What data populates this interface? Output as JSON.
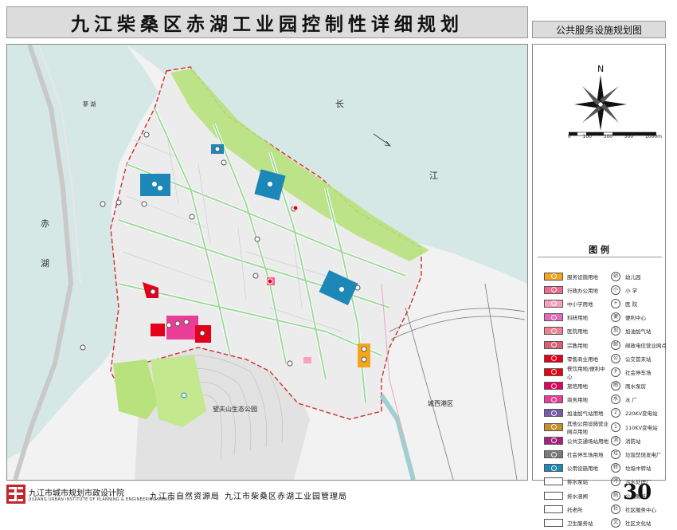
{
  "header": {
    "title": "九江柴桑区赤湖工业园控制性详细规划",
    "subtitle": "公共服务设施规划图"
  },
  "map": {
    "labels": {
      "river_chang": "长",
      "river_jiang": "江",
      "lake_chi": "赤",
      "lake_hu": "湖",
      "lake_liao": "蓼 湖",
      "park": "望夫山生态公园",
      "district": "城西港区"
    }
  },
  "compass": {
    "north_label": "N"
  },
  "scale": {
    "ticks": [
      "0",
      "100",
      "300",
      "500",
      "1000m"
    ]
  },
  "legend": {
    "title": "图 例",
    "left": [
      {
        "label": "服务设施用地",
        "color": "#f4a51c"
      },
      {
        "label": "行政办公用地",
        "color": "#f06a8f"
      },
      {
        "label": "中小学用地",
        "color": "#f7a1be"
      },
      {
        "label": "科研用地",
        "color": "#e26bb8"
      },
      {
        "label": "医院用地",
        "color": "#f08090"
      },
      {
        "label": "宗教用地",
        "color": "#d96073"
      },
      {
        "label": "零售商业用地",
        "color": "#e3001b"
      },
      {
        "label": "餐饮用地/便利中心",
        "color": "#e60012"
      },
      {
        "label": "旅馆用地",
        "color": "#e40062"
      },
      {
        "label": "商务用地",
        "color": "#ea3d98"
      },
      {
        "label": "加油加气站用地",
        "color": "#7a5aa6"
      },
      {
        "label": "其他公用设施营业网点用地",
        "color": "#c58f2a"
      },
      {
        "label": "公共交通场站用地",
        "color": "#a3227f"
      },
      {
        "label": "社会停车场用地",
        "color": "#7a7a7a"
      },
      {
        "label": "公用设施用地",
        "color": "#1d87b7"
      },
      {
        "label": "排水泵站",
        "color": "#ffffff"
      },
      {
        "label": "排水涵闸",
        "color": "#ffffff"
      },
      {
        "label": "托老所",
        "color": "#ffffff"
      },
      {
        "label": "卫生服务站",
        "color": "#ffffff"
      }
    ],
    "right": [
      {
        "label": "幼儿园",
        "symbol": "幼"
      },
      {
        "label": "小 学",
        "symbol": "小"
      },
      {
        "label": "医 院",
        "symbol": "+"
      },
      {
        "label": "便利中心",
        "symbol": "便"
      },
      {
        "label": "加油加气站",
        "symbol": "加"
      },
      {
        "label": "邮政电信营业网点",
        "symbol": "邮"
      },
      {
        "label": "公交首末站",
        "symbol": "公"
      },
      {
        "label": "社会停车场",
        "symbol": "P"
      },
      {
        "label": "雨水泵房",
        "symbol": "雨"
      },
      {
        "label": "水 厂",
        "symbol": "水"
      },
      {
        "label": "220KV变电站",
        "symbol": "2"
      },
      {
        "label": "110KV变电站",
        "symbol": "1"
      },
      {
        "label": "消防站",
        "symbol": "消"
      },
      {
        "label": "垃圾焚烧发电厂",
        "symbol": "垃"
      },
      {
        "label": "垃圾中转站",
        "symbol": "转"
      },
      {
        "label": "污水处理厂",
        "symbol": "污"
      },
      {
        "label": "公共厕所",
        "symbol": "厕"
      },
      {
        "label": "社区服务中心",
        "symbol": "社"
      },
      {
        "label": "社区文化站",
        "symbol": "文"
      }
    ]
  },
  "footer": {
    "org_cn": "九江市城市规划市政设计院",
    "org_en": "JIUJIANG URBAN INSTITUTE OF PLANNING & ENGINEERING DESIGN",
    "dept1": "九江市自然资源局",
    "dept2": "九江市柴桑区赤湖工业园管理局",
    "page": "30"
  }
}
